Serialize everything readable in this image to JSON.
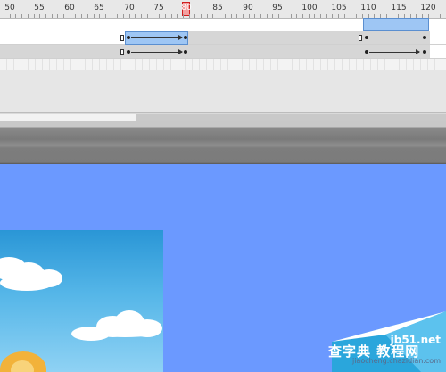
{
  "timeline": {
    "ruler_labels": [
      "50",
      "55",
      "60",
      "65",
      "70",
      "75",
      "80",
      "85",
      "90",
      "95",
      "100",
      "105",
      "110",
      "115",
      "120"
    ],
    "current_frame": "80"
  },
  "colors": {
    "stage_background": "#6b99ff",
    "playhead": "#d02020",
    "tween_span": "#9ec6f4",
    "frame_fill": "#d6d6d6"
  },
  "watermark": {
    "line1": "jb51.net",
    "line2": "查字典 教程网",
    "line3": "jiaocheng.chazidian.com"
  },
  "icons": {
    "keyframe": "solid-dot-keyframe",
    "empty_keyframe": "hollow-keyframe",
    "tween": "motion-tween-arrow"
  }
}
